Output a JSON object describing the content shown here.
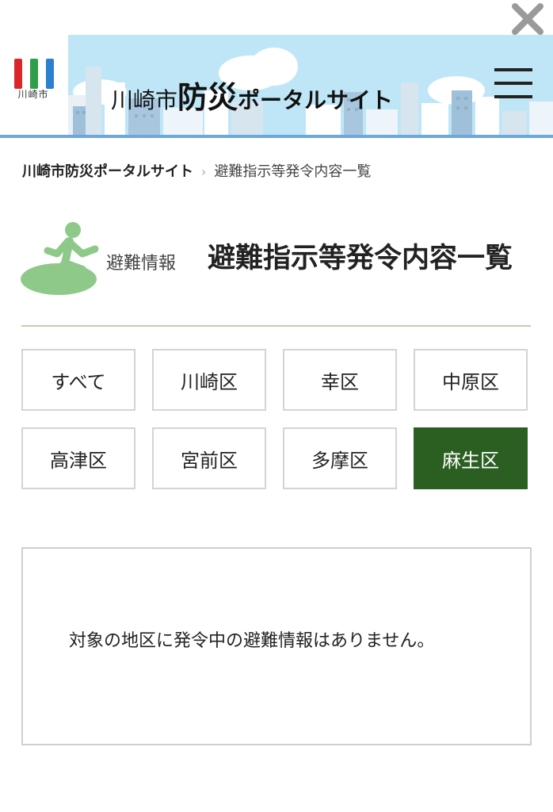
{
  "header": {
    "logo_text": "川崎市",
    "title_part1": "川崎市",
    "title_part2": "防災",
    "title_part3": "ポータルサイト"
  },
  "breadcrumb": {
    "home": "川崎市防災ポータルサイト",
    "separator": "›",
    "current": "避難指示等発令内容一覧"
  },
  "section": {
    "label": "避難情報",
    "title": "避難指示等発令内容一覧"
  },
  "districts": [
    {
      "label": "すべて",
      "active": false
    },
    {
      "label": "川崎区",
      "active": false
    },
    {
      "label": "幸区",
      "active": false
    },
    {
      "label": "中原区",
      "active": false
    },
    {
      "label": "高津区",
      "active": false
    },
    {
      "label": "宮前区",
      "active": false
    },
    {
      "label": "多摩区",
      "active": false
    },
    {
      "label": "麻生区",
      "active": true
    }
  ],
  "message": "対象の地区に発令中の避難情報はありません。",
  "colors": {
    "active_tab": "#2b5f22",
    "banner_sky": "#bfe6f7",
    "logo_red": "#d9262b",
    "logo_green": "#2f9e48",
    "logo_blue": "#2a7fd0",
    "evac_icon_green": "#8fc98a"
  },
  "icons": {
    "close": "close-x-icon",
    "menu": "hamburger-menu-icon",
    "evacuation": "running-person-exit-icon"
  }
}
